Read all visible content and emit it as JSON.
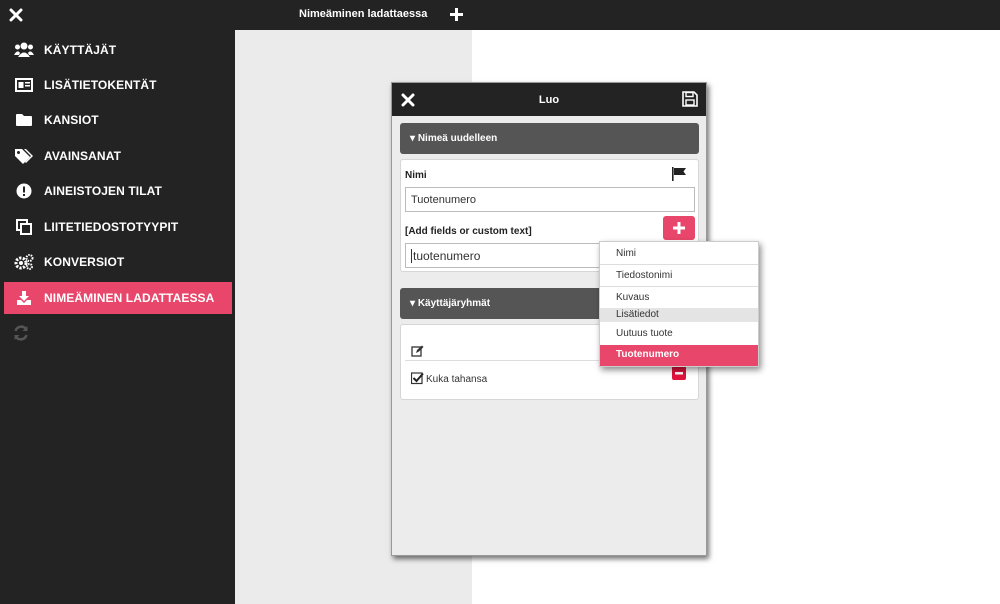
{
  "sidebar": {
    "items": [
      {
        "label": "KÄYTTÄJÄT",
        "icon": "users-icon"
      },
      {
        "label": "LISÄTIETOKENTÄT",
        "icon": "id-card-icon"
      },
      {
        "label": "KANSIOT",
        "icon": "folder-icon"
      },
      {
        "label": "AVAINSANAT",
        "icon": "tags-icon"
      },
      {
        "label": "AINEISTOJEN TILAT",
        "icon": "exclamation-icon"
      },
      {
        "label": "LIITETIEDOSTOTYYPIT",
        "icon": "copy-icon"
      },
      {
        "label": "KONVERSIOT",
        "icon": "cogs-icon"
      },
      {
        "label": "NIMEÄMINEN LADATTAESSA",
        "icon": "download-icon"
      }
    ],
    "active_index": 7
  },
  "topbar": {
    "tab_label": "Nimeäminen ladattaessa"
  },
  "dialog": {
    "title": "Luo",
    "rename_section": "Nimeä uudelleen",
    "name_label": "Nimi",
    "name_value": "Tuotenumero",
    "fields_label": "[Add fields or custom text]",
    "pattern_value": "tuotenumero",
    "groups_section": "Käyttäjäryhmät",
    "group_item": "Kuka tahansa"
  },
  "menu": {
    "items": [
      "Nimi",
      "Tiedostonimi",
      "Kuvaus"
    ],
    "group_label": "Lisätiedot",
    "group_items": [
      "Uutuus tuote",
      "Tuotenumero"
    ],
    "selected": "Tuotenumero"
  },
  "colors": {
    "accent": "#e8466a",
    "dark": "#232323"
  }
}
